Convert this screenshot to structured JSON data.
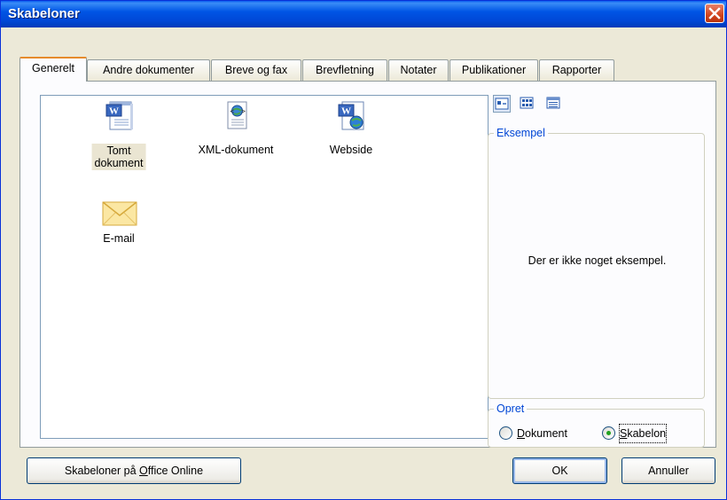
{
  "window": {
    "title": "Skabeloner"
  },
  "tabs": [
    {
      "label": "Generelt",
      "active": true
    },
    {
      "label": "Andre dokumenter"
    },
    {
      "label": "Breve og fax"
    },
    {
      "label": "Brevfletning"
    },
    {
      "label": "Notater"
    },
    {
      "label": "Publikationer"
    },
    {
      "label": "Rapporter"
    }
  ],
  "templates": [
    {
      "label": "Tomt dokument",
      "icon": "word-document-icon",
      "selected": true
    },
    {
      "label": "XML-dokument",
      "icon": "xml-document-icon"
    },
    {
      "label": "Webside",
      "icon": "web-page-icon"
    },
    {
      "label": "E-mail",
      "icon": "email-envelope-icon"
    }
  ],
  "view_buttons": [
    "large-icons-view-icon",
    "list-view-icon",
    "details-view-icon"
  ],
  "preview": {
    "legend": "Eksempel",
    "message": "Der er ikke noget eksempel."
  },
  "create": {
    "legend": "Opret",
    "options": [
      {
        "label": "Dokument",
        "mnemonic": "D",
        "rest": "okument",
        "checked": false
      },
      {
        "label": "Skabelon",
        "mnemonic": "S",
        "rest": "kabelon",
        "checked": true
      }
    ]
  },
  "buttons": {
    "office_online_pre": "Skabeloner på ",
    "office_online_mn": "O",
    "office_online_post": "ffice Online",
    "ok": "OK",
    "cancel": "Annuller"
  },
  "colors": {
    "title_bar": "#0055e5",
    "accent_tab": "#e68b2c",
    "group_legend": "#0046d5"
  }
}
